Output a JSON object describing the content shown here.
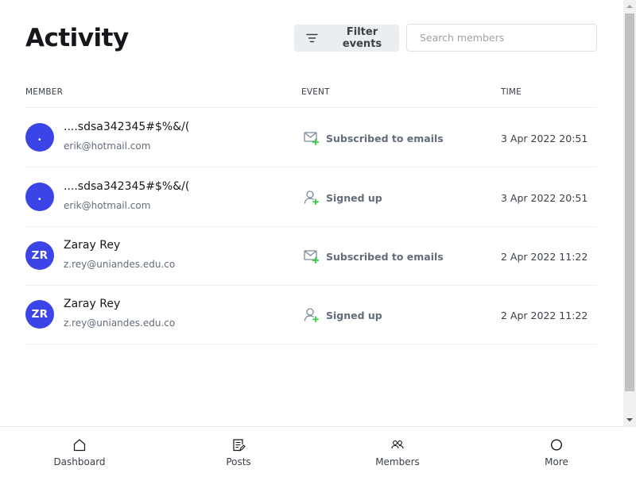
{
  "header": {
    "title": "Activity",
    "filter_label": "Filter events",
    "search_placeholder": "Search members"
  },
  "columns": {
    "member": "MEMBER",
    "event": "EVENT",
    "time": "TIME"
  },
  "rows": [
    {
      "initials": ".",
      "name": "....sdsa342345#$%&/(",
      "email": "erik@hotmail.com",
      "event_icon": "envelope-plus-icon",
      "event": "Subscribed to emails",
      "time": "3 Apr 2022 20:51"
    },
    {
      "initials": ".",
      "name": "....sdsa342345#$%&/(",
      "email": "erik@hotmail.com",
      "event_icon": "user-plus-icon",
      "event": "Signed up",
      "time": "3 Apr 2022 20:51"
    },
    {
      "initials": "ZR",
      "name": "Zaray Rey",
      "email": "z.rey@uniandes.edu.co",
      "event_icon": "envelope-plus-icon",
      "event": "Subscribed to emails",
      "time": "2 Apr 2022 11:22"
    },
    {
      "initials": "ZR",
      "name": "Zaray Rey",
      "email": "z.rey@uniandes.edu.co",
      "event_icon": "user-plus-icon",
      "event": "Signed up",
      "time": "2 Apr 2022 11:22"
    }
  ],
  "nav": {
    "items": [
      {
        "label": "Dashboard",
        "icon": "home-icon"
      },
      {
        "label": "Posts",
        "icon": "posts-icon"
      },
      {
        "label": "Members",
        "icon": "members-icon"
      },
      {
        "label": "More",
        "icon": "circle-icon"
      }
    ]
  },
  "colors": {
    "avatar_bg": "#3b44e6",
    "event_icon_accent": "#30cf43",
    "filter_bg": "#ebeef0"
  }
}
